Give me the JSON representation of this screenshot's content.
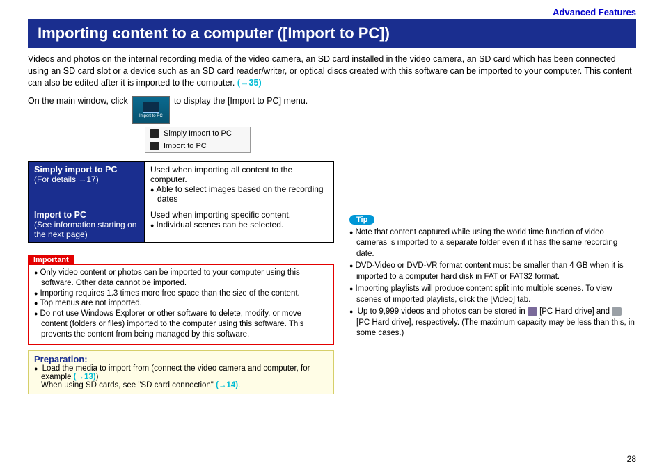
{
  "header_link": "Advanced Features",
  "title": "Importing content to a computer ([Import to PC])",
  "intro": "Videos and photos on the internal recording media of the video camera, an SD card installed in the video camera, an SD card which has been connected using an SD card slot or a device such as an SD card reader/writer, or optical discs created with this software can be imported to your computer. This content can also be edited after it is imported to the computer.",
  "intro_ref": "(→35)",
  "click_pre": "On the main window, click",
  "click_post": "to display the [Import to PC] menu.",
  "btn_label": "Import to PC",
  "menu": {
    "item1": "Simply Import to PC",
    "item2": "Import to PC"
  },
  "table": {
    "r1_label_b": "Simply import to PC",
    "r1_label_s": "(For details →17)",
    "r1_desc1": "Used when importing all content to the computer.",
    "r1_desc2": "Able to select images based on the recording dates",
    "r2_label_b": "Import to PC",
    "r2_label_s": "(See information starting on the next page)",
    "r2_desc1": "Used when importing specific content.",
    "r2_desc2": "Individual scenes can be selected."
  },
  "important_tag": "Important",
  "important": {
    "b1": "Only video content or photos can be imported to your computer using this software. Other data cannot be imported.",
    "b2": "Importing requires 1.3 times more free space than the size of the content.",
    "b3": "Top menus are not imported.",
    "b4": "Do not use Windows Explorer or other software to delete, modify, or move content (folders or files) imported to the computer using this software. This prevents the content from being managed by this software."
  },
  "prep": {
    "hdr": "Preparation:",
    "b1a": "Load the media to import from (connect the video camera and computer, for example ",
    "b1ref": "(→13)",
    "b1b": ")",
    "b1c": "When using SD cards, see \"SD card connection\" ",
    "b1cref": "(→14)",
    "b1d": "."
  },
  "tip_tag": "Tip",
  "tips": {
    "t1": "Note that content captured while using the world time function of video cameras is imported to a separate folder even if it has the same recording date.",
    "t2": "DVD-Video or DVD-VR format content must be smaller than 4 GB when it is imported to a computer hard disk in FAT or FAT32 format.",
    "t3": "Importing playlists will produce content split into multiple scenes. To view scenes of imported playlists, click the [Video] tab.",
    "t4a": "Up to 9,999 videos and photos can be stored in ",
    "t4b": " [PC Hard drive] and ",
    "t4c": " [PC Hard drive], respectively. (The maximum capacity may be less than this, in some cases.)"
  },
  "page_number": "28"
}
